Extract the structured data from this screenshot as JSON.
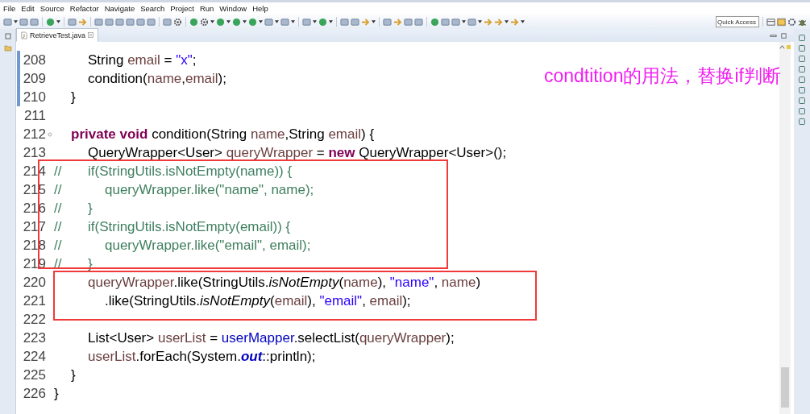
{
  "menu": [
    "File",
    "Edit",
    "Source",
    "Refactor",
    "Navigate",
    "Search",
    "Project",
    "Run",
    "Window",
    "Help"
  ],
  "quick_access": {
    "placeholder": "Quick Access"
  },
  "tabs": [
    {
      "label": "RetrieveTest.java",
      "selected": true
    }
  ],
  "editor": {
    "lines": [
      {
        "number": "208",
        "changed": true,
        "tokens": [
          {
            "text": "\t\tString ",
            "kind": "plain"
          },
          {
            "text": "email",
            "kind": "var"
          },
          {
            "text": " = ",
            "kind": "plain"
          },
          {
            "text": "\"x\"",
            "kind": "str"
          },
          {
            "text": ";",
            "kind": "plain"
          }
        ]
      },
      {
        "number": "209",
        "changed": true,
        "tokens": [
          {
            "text": "\t\tcondition(",
            "kind": "plain"
          },
          {
            "text": "name",
            "kind": "var"
          },
          {
            "text": ",",
            "kind": "plain"
          },
          {
            "text": "email",
            "kind": "var"
          },
          {
            "text": ");",
            "kind": "plain"
          }
        ]
      },
      {
        "number": "210",
        "changed": true,
        "tokens": [
          {
            "text": "\t}",
            "kind": "plain"
          }
        ]
      },
      {
        "number": "211",
        "changed": false
      },
      {
        "number": "212",
        "changed": false,
        "folding": true,
        "tokens": [
          {
            "text": "\tprivate void",
            "kind": "kw"
          },
          {
            "text": " condition(String ",
            "kind": "plain"
          },
          {
            "text": "name",
            "kind": "var"
          },
          {
            "text": ",String ",
            "kind": "plain"
          },
          {
            "text": "email",
            "kind": "var"
          },
          {
            "text": ") {",
            "kind": "plain"
          }
        ]
      },
      {
        "number": "213",
        "changed": false,
        "tokens": [
          {
            "text": "\t\tQueryWrapper<User> ",
            "kind": "plain"
          },
          {
            "text": "queryWrapper",
            "kind": "var"
          },
          {
            "text": " = ",
            "kind": "plain"
          },
          {
            "text": "new",
            "kind": "kw"
          },
          {
            "text": " QueryWrapper<User>();",
            "kind": "plain"
          }
        ]
      },
      {
        "number": "214",
        "changed": false,
        "tokens": [
          {
            "text": "//\t\tif(StringUtils.isNotEmpty(name)) {",
            "kind": "comment"
          }
        ]
      },
      {
        "number": "215",
        "changed": false,
        "tokens": [
          {
            "text": "//\t\t\tqueryWrapper.like(\"name\", name);",
            "kind": "comment"
          }
        ]
      },
      {
        "number": "216",
        "changed": false,
        "tokens": [
          {
            "text": "//\t\t}",
            "kind": "comment"
          }
        ]
      },
      {
        "number": "217",
        "changed": false,
        "tokens": [
          {
            "text": "//\t\tif(StringUtils.isNotEmpty(email)) {",
            "kind": "comment"
          }
        ]
      },
      {
        "number": "218",
        "changed": false,
        "tokens": [
          {
            "text": "//\t\t\tqueryWrapper.like(\"email\", email);",
            "kind": "comment"
          }
        ]
      },
      {
        "number": "219",
        "changed": false,
        "tokens": [
          {
            "text": "//\t\t}",
            "kind": "comment"
          }
        ]
      },
      {
        "number": "220",
        "changed": false,
        "tokens": [
          {
            "text": "\t\tqueryWrapper",
            "kind": "var"
          },
          {
            "text": ".like(StringUtils.",
            "kind": "plain"
          },
          {
            "text": "isNotEmpty",
            "kind": "static"
          },
          {
            "text": "(",
            "kind": "plain"
          },
          {
            "text": "name",
            "kind": "var"
          },
          {
            "text": "), ",
            "kind": "plain"
          },
          {
            "text": "\"name\"",
            "kind": "str"
          },
          {
            "text": ", ",
            "kind": "plain"
          },
          {
            "text": "name",
            "kind": "var"
          },
          {
            "text": ")",
            "kind": "plain"
          }
        ]
      },
      {
        "number": "221",
        "changed": false,
        "tokens": [
          {
            "text": "\t\t\t.like(StringUtils.",
            "kind": "plain"
          },
          {
            "text": "isNotEmpty",
            "kind": "static"
          },
          {
            "text": "(",
            "kind": "plain"
          },
          {
            "text": "email",
            "kind": "var"
          },
          {
            "text": "), ",
            "kind": "plain"
          },
          {
            "text": "\"email\"",
            "kind": "str"
          },
          {
            "text": ", ",
            "kind": "plain"
          },
          {
            "text": "email",
            "kind": "var"
          },
          {
            "text": ");",
            "kind": "plain"
          }
        ]
      },
      {
        "number": "222",
        "changed": false
      },
      {
        "number": "223",
        "changed": false,
        "tokens": [
          {
            "text": "\t\tList<User> ",
            "kind": "plain"
          },
          {
            "text": "userList",
            "kind": "var"
          },
          {
            "text": " = ",
            "kind": "plain"
          },
          {
            "text": "userMapper",
            "kind": "field"
          },
          {
            "text": ".selectList(",
            "kind": "plain"
          },
          {
            "text": "queryWrapper",
            "kind": "var"
          },
          {
            "text": ");",
            "kind": "plain"
          }
        ]
      },
      {
        "number": "224",
        "changed": false,
        "tokens": [
          {
            "text": "\t\tuserList",
            "kind": "var"
          },
          {
            "text": ".forEach(System.",
            "kind": "plain"
          },
          {
            "text": "out",
            "kind": "static_field"
          },
          {
            "text": "::println);",
            "kind": "plain"
          }
        ]
      },
      {
        "number": "225",
        "changed": false,
        "tokens": [
          {
            "text": "\t}",
            "kind": "plain"
          }
        ]
      },
      {
        "number": "226",
        "changed": false,
        "tokens": [
          {
            "text": "}",
            "kind": "plain"
          }
        ]
      }
    ]
  },
  "annotation": "condtition的用法，替换if判断"
}
